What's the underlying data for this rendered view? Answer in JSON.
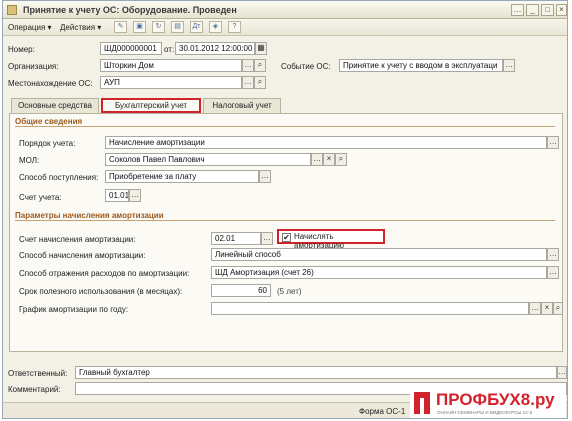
{
  "window": {
    "title": "Принятие к учету ОС: Оборудование. Проведен"
  },
  "toolbar": {
    "operation": "Операция",
    "actions": "Действия"
  },
  "header": {
    "number_label": "Номер:",
    "number": "ШД000000001",
    "date_label": "от:",
    "date": "30.01.2012 12:00:00",
    "org_label": "Организация:",
    "org": "Шторкин Дом",
    "event_label": "Событие ОС:",
    "event": "Принятие к учету с вводом в эксплуатаци",
    "location_label": "Местонахождение ОС:",
    "location": "АУП"
  },
  "tabs": [
    "Основные средства",
    "Бухгалтерский учет",
    "Налоговый учет"
  ],
  "general": {
    "title": "Общие сведения",
    "order_label": "Порядок учета:",
    "order": "Начисление амортизации",
    "mol_label": "МОЛ:",
    "mol": "Соколов Павел Павлович",
    "receipt_label": "Способ поступления:",
    "receipt": "Приобретение за плату",
    "account_label": "Счет учета:",
    "account": "01.01"
  },
  "depreciation": {
    "title": "Параметры начисления амортизации",
    "account_label": "Счет начисления амортизации:",
    "account": "02.01",
    "check_label": "Начислять амортизацию",
    "checked": true,
    "method_label": "Способ начисления амортизации:",
    "method": "Линейный способ",
    "expense_label": "Способ отражения расходов по амортизации:",
    "expense": "ШД Амортизация (счет 26)",
    "term_label": "Срок полезного использования (в месяцах):",
    "term": "60",
    "term_years": "(5 лет)",
    "schedule_label": "График амортизации по году:",
    "schedule": ""
  },
  "footer": {
    "responsible_label": "Ответственный:",
    "responsible": "Главный бухгалтер",
    "comment_label": "Комментарий:",
    "comment": "",
    "form": "Форма ОС-1"
  },
  "brand": {
    "name": "ПРОФБУХ8.ру",
    "tagline": "ОНЛАЙН-СЕМИНАРЫ И ВИДЕОКУРСЫ 1С:8",
    "color": "#d2222b"
  }
}
